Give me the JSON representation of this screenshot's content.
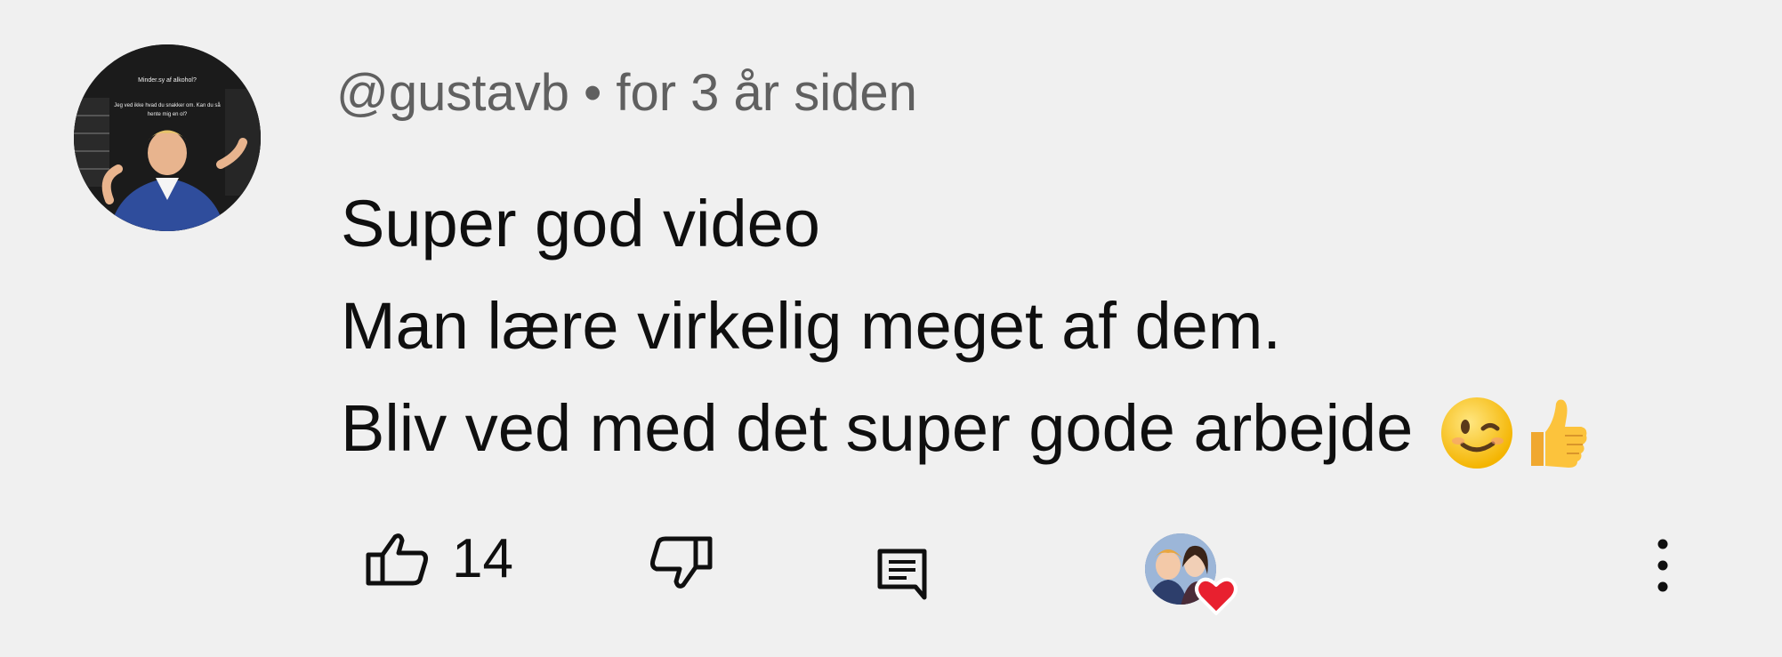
{
  "comment": {
    "author": "@gustavb",
    "separator": "•",
    "timestamp": "for 3 år siden",
    "lines": [
      "Super god video",
      "Man lære virkelig meget af dem.",
      "Bliv ved med det super gode arbejde"
    ],
    "trailing_emojis": [
      "winking-face-icon",
      "thumbs-up-icon"
    ]
  },
  "avatar": {
    "caption_lines": [
      "Minder.sy af alkohol?",
      "Jeg ved ikke hvad du snakker om. Kan du så",
      "hente mig en ol?"
    ]
  },
  "actions": {
    "like_icon": "thumbs-up-outline-icon",
    "like_count": "14",
    "dislike_icon": "thumbs-down-outline-icon",
    "reply_icon": "comment-reply-icon",
    "creator_heart_icon": "creator-heart-avatar-icon",
    "more_icon": "more-vertical-icon"
  },
  "colors": {
    "background": "#f0f0f0",
    "meta_text": "#606060",
    "body_text": "#0f0f0f",
    "heart": "#e8202f"
  }
}
